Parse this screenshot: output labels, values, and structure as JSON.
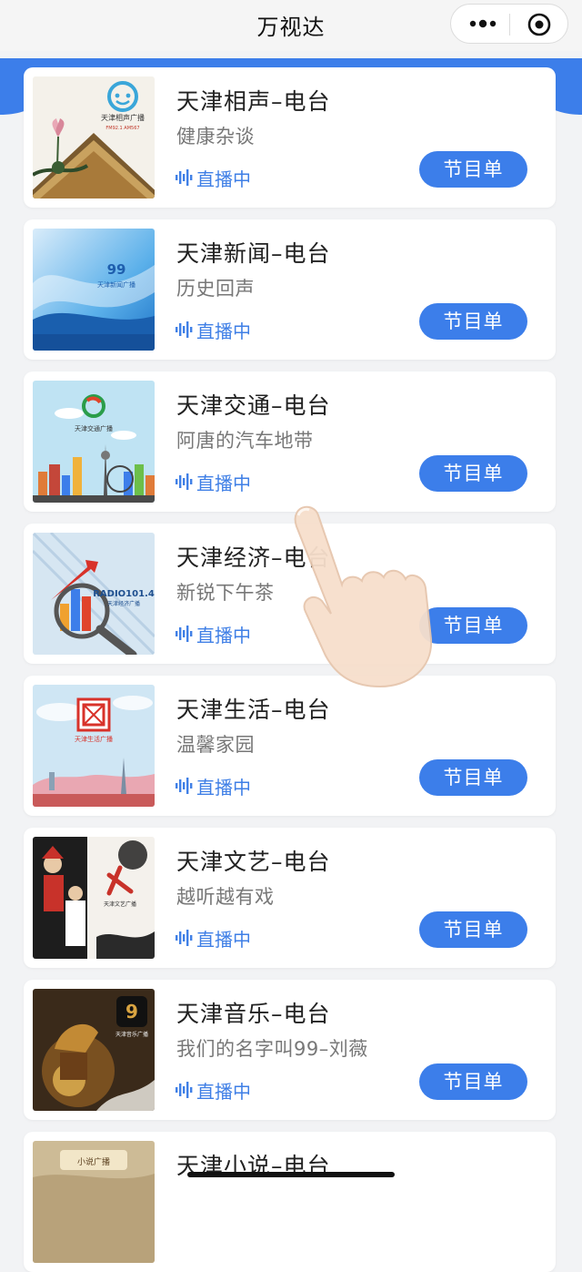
{
  "app": {
    "title": "万视达"
  },
  "stations": [
    {
      "name": "天津相声–电台",
      "program": "健康杂谈",
      "live_label": "直播中",
      "button_label": "节目单",
      "thumb": "crosstalk-radio-art"
    },
    {
      "name": "天津新闻–电台",
      "program": "历史回声",
      "live_label": "直播中",
      "button_label": "节目单",
      "thumb": "news-radio-art"
    },
    {
      "name": "天津交通–电台",
      "program": "阿唐的汽车地带",
      "live_label": "直播中",
      "button_label": "节目单",
      "thumb": "traffic-radio-art"
    },
    {
      "name": "天津经济–电台",
      "program": "新锐下午茶",
      "live_label": "直播中",
      "button_label": "节目单",
      "thumb": "economy-radio-art"
    },
    {
      "name": "天津生活–电台",
      "program": "温馨家园",
      "live_label": "直播中",
      "button_label": "节目单",
      "thumb": "life-radio-art"
    },
    {
      "name": "天津文艺–电台",
      "program": "越听越有戏",
      "live_label": "直播中",
      "button_label": "节目单",
      "thumb": "arts-radio-art"
    },
    {
      "name": "天津音乐–电台",
      "program": "我们的名字叫99–刘薇",
      "live_label": "直播中",
      "button_label": "节目单",
      "thumb": "music-radio-art"
    },
    {
      "name": "天津小说–电台",
      "program": "",
      "live_label": "",
      "button_label": "",
      "thumb": "novel-radio-art"
    }
  ],
  "logos": {
    "crosstalk": "天津相声广播",
    "crosstalk_freq": "FM92.1 AM567",
    "news": "天津新闻广播",
    "traffic": "天津交通广播",
    "economy": "RADIO101.4",
    "economy_sub": "天津经济广播",
    "life": "天津生活广播",
    "arts": "天津文艺广播",
    "music": "天津音乐广播",
    "novel": "小说广播"
  },
  "colors": {
    "accent": "#3c7eea",
    "live_text": "#3f7fe6",
    "background": "#f2f3f5"
  }
}
